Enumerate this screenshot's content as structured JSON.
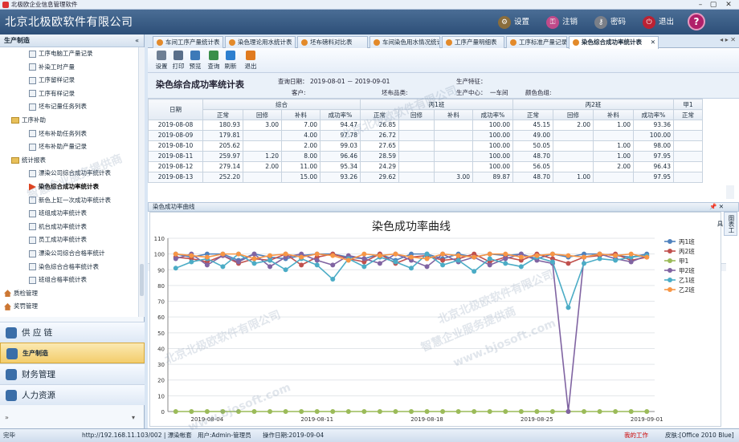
{
  "window": {
    "title": "北极欧企业信息管理软件",
    "btn_min": "–",
    "btn_max": "▢",
    "btn_close": "✕"
  },
  "banner": {
    "title": "北京北极欧软件有限公司",
    "settings": "设置",
    "logout": "注销",
    "password": "密码",
    "exit": "退出",
    "help": "?"
  },
  "sidebar": {
    "header": "生产制造",
    "header_close": "«",
    "items": [
      "工序电脑工产量记录",
      "补染工时产量",
      "工序留样记录",
      "工序有样记录",
      "坯布记量任务列表",
      "工序补助",
      "坯布补助任务列表",
      "坯布补助产量记录",
      "统计报表",
      "漂染公司综合成功率统计表",
      "染色综合成功率统计表",
      "新色上缸一次成功率统计表",
      "班组成功率统计表",
      "机台成功率统计表",
      "员工成功率统计表",
      "漂染公司综合合格率统计",
      "染色综合合格率统计表",
      "班组合格率统计表",
      "质检管理",
      "奖罚管理"
    ],
    "nav": [
      "供 应 链",
      "生产制造",
      "财务管理",
      "人力资源"
    ],
    "nav_ctl_left": "»",
    "nav_ctl_right": "▾"
  },
  "tabs": [
    "车间工序产量统计表",
    "染色理论用水统计表",
    "坯布磅料对比表",
    "车间染色用水情况统计表",
    "工序产量明细表",
    "工序标准产量记录",
    "染色综合成功率统计表"
  ],
  "tab_close": "✕",
  "tab_ctl": "◂ ▸ ✕",
  "toolbar": [
    "设置",
    "打印",
    "预览",
    "查询",
    "刷新",
    "退出"
  ],
  "report": {
    "title": "染色综合成功率统计表",
    "query_date_label": "查询日期：",
    "query_date": "2019-08-01 － 2019-09-01",
    "customer_label": "客户:",
    "fabric_label": "坯布品类:",
    "feature_label": "生产特征：",
    "center_label": "生产中心：",
    "center": "一车间",
    "color_group_label": "颜色色组:"
  },
  "grid": {
    "date_header": "日期",
    "groups": [
      "综合",
      "丙1班",
      "丙2班",
      "甲1"
    ],
    "sub": [
      "正常",
      "回修",
      "补料",
      "成功率%"
    ],
    "sub_last": "正常",
    "rows": [
      [
        "2019-08-08",
        "180.93",
        "3.00",
        "7.00",
        "94.47",
        "26.85",
        "",
        "",
        "100.00",
        "45.15",
        "2.00",
        "1.00",
        "93.36"
      ],
      [
        "2019-08-09",
        "179.81",
        "",
        "4.00",
        "97.78",
        "26.72",
        "",
        "",
        "100.00",
        "49.00",
        "",
        "",
        "100.00"
      ],
      [
        "2019-08-10",
        "205.62",
        "",
        "2.00",
        "99.03",
        "27.65",
        "",
        "",
        "100.00",
        "50.05",
        "",
        "1.00",
        "98.00"
      ],
      [
        "2019-08-11",
        "259.97",
        "1.20",
        "8.00",
        "96.46",
        "28.59",
        "",
        "",
        "100.00",
        "48.70",
        "",
        "1.00",
        "97.95"
      ],
      [
        "2019-08-12",
        "279.14",
        "2.00",
        "11.00",
        "95.34",
        "24.29",
        "",
        "",
        "100.00",
        "56.05",
        "",
        "2.00",
        "96.43"
      ],
      [
        "2019-08-13",
        "252.20",
        "",
        "15.00",
        "93.26",
        "29.62",
        "",
        "3.00",
        "89.87",
        "48.70",
        "1.00",
        "",
        "97.95"
      ]
    ]
  },
  "chart_panel": {
    "header": "染色成功率曲线",
    "pin": "📌 ✕",
    "side_tool": "图表工具"
  },
  "chart_data": {
    "type": "line",
    "title": "染色成功率曲线",
    "ylim": [
      0,
      110
    ],
    "yticks": [
      0,
      10,
      20,
      30,
      40,
      50,
      60,
      70,
      80,
      90,
      100,
      110
    ],
    "xlabels": [
      "2019-08-04",
      "2019-08-11",
      "2019-08-18",
      "2019-08-25",
      "2019-09-01"
    ],
    "xlabel_index": [
      2,
      9,
      16,
      23,
      30
    ],
    "legend_position": "right",
    "series": [
      {
        "name": "丙1班",
        "color": "#4f81bd",
        "values": [
          100,
          98,
          100,
          100,
          96,
          100,
          98,
          97,
          99,
          100,
          100,
          98,
          97,
          100,
          96,
          100,
          100,
          97,
          100,
          98,
          100,
          99,
          100,
          97,
          100,
          98,
          100,
          100,
          99,
          98,
          100
        ]
      },
      {
        "name": "丙2班",
        "color": "#c0504d",
        "values": [
          98,
          97,
          95,
          99,
          94,
          97,
          96,
          100,
          93,
          98,
          100,
          97,
          95,
          100,
          94,
          98,
          99,
          96,
          97,
          100,
          95,
          98,
          96,
          100,
          97,
          94,
          98,
          99,
          100,
          96,
          98
        ]
      },
      {
        "name": "甲1",
        "color": "#9bbb59",
        "values": [
          0,
          0,
          0,
          0,
          0,
          0,
          0,
          0,
          0,
          0,
          0,
          0,
          0,
          0,
          0,
          0,
          0,
          0,
          0,
          0,
          0,
          0,
          0,
          0,
          0,
          0,
          0,
          0,
          0,
          0,
          0
        ]
      },
      {
        "name": "甲2班",
        "color": "#8064a2",
        "values": [
          97,
          100,
          93,
          99,
          95,
          100,
          92,
          98,
          100,
          96,
          93,
          99,
          97,
          94,
          100,
          96,
          92,
          100,
          95,
          98,
          93,
          97,
          100,
          96,
          94,
          0,
          98,
          100,
          97,
          95,
          99
        ]
      },
      {
        "name": "乙1班",
        "color": "#4bacc6",
        "values": [
          91,
          95,
          97,
          92,
          100,
          94,
          96,
          90,
          97,
          93,
          84,
          97,
          92,
          98,
          95,
          91,
          100,
          93,
          96,
          89,
          97,
          94,
          92,
          98,
          95,
          66,
          94,
          97,
          96,
          98,
          99
        ]
      },
      {
        "name": "乙2班",
        "color": "#f79646",
        "values": [
          100,
          99,
          98,
          100,
          100,
          97,
          99,
          100,
          98,
          100,
          99,
          96,
          100,
          99,
          100,
          98,
          97,
          100,
          99,
          98,
          100,
          100,
          98,
          99,
          100,
          99,
          98,
          100,
          99,
          100,
          98
        ]
      }
    ]
  },
  "status": {
    "ready": "完毕",
    "url": "http://192.168.11.103/002 | 漂染帐套",
    "user": "用户:Admin-管理员",
    "op_date": "操作日期:2019-09-04",
    "my_work": "我的工作",
    "skin": "皮肤:[Office 2010 Blue]"
  },
  "watermark": {
    "a": "北京北极欧软件有限公司",
    "b": "智慧企业服务提供商",
    "c": "www.bjosoft.com"
  },
  "colors": {
    "banner": "#2d4f78",
    "accent": "#f3cd6c"
  }
}
